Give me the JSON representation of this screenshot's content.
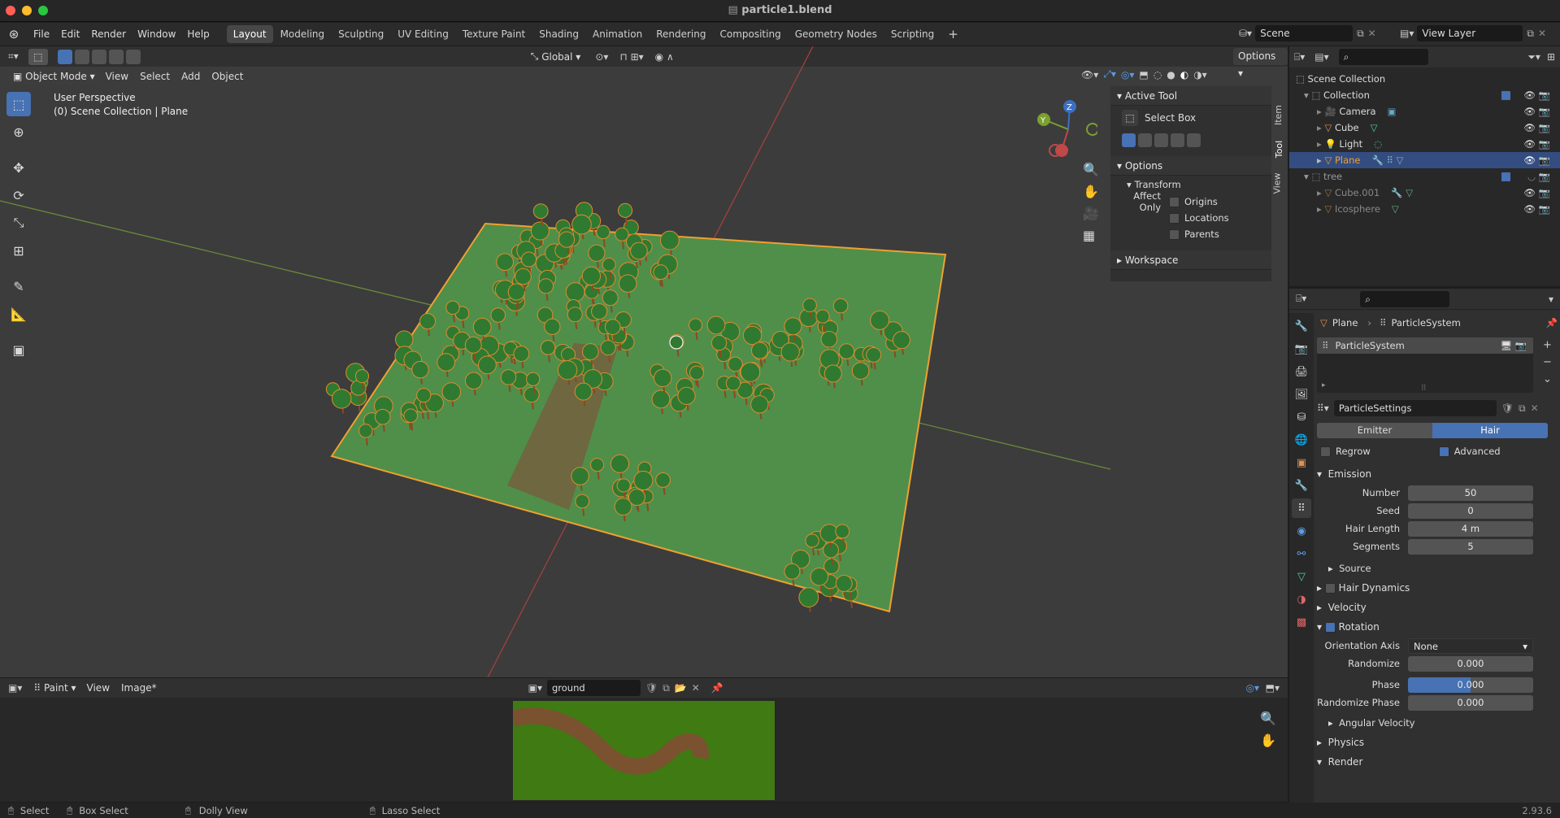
{
  "window": {
    "title": "particle1.blend"
  },
  "menu": [
    "File",
    "Edit",
    "Render",
    "Window",
    "Help"
  ],
  "workspaces": [
    "Layout",
    "Modeling",
    "Sculpting",
    "UV Editing",
    "Texture Paint",
    "Shading",
    "Animation",
    "Rendering",
    "Compositing",
    "Geometry Nodes",
    "Scripting"
  ],
  "scene": {
    "label": "Scene",
    "view_layer": "View Layer"
  },
  "viewport": {
    "mode": "Object Mode",
    "menus": [
      "View",
      "Select",
      "Add",
      "Object"
    ],
    "transform_orientation": "Global",
    "options": "Options",
    "perspective": "User Perspective",
    "collection_info": "(0) Scene Collection | Plane",
    "gizmo": {
      "x": "X",
      "y": "Y",
      "z": "Z"
    }
  },
  "npanel": {
    "tabs": [
      "Item",
      "Tool",
      "View"
    ],
    "active_tool_header": "Active Tool",
    "active_tool": "Select Box",
    "options_header": "Options",
    "transform_header": "Transform",
    "affect_only": "Affect Only",
    "origins": "Origins",
    "locations": "Locations",
    "parents": "Parents",
    "workspace_header": "Workspace"
  },
  "outliner": {
    "rows": [
      {
        "label": "Scene Collection"
      },
      {
        "label": "Collection"
      },
      {
        "label": "Camera"
      },
      {
        "label": "Cube"
      },
      {
        "label": "Light"
      },
      {
        "label": "Plane"
      },
      {
        "label": "tree"
      },
      {
        "label": "Cube.001"
      },
      {
        "label": "Icosphere"
      }
    ]
  },
  "properties": {
    "breadcrumb_object": "Plane",
    "breadcrumb_system": "ParticleSystem",
    "list_item": "ParticleSystem",
    "settings": "ParticleSettings",
    "type_emitter": "Emitter",
    "type_hair": "Hair",
    "regrow": "Regrow",
    "advanced": "Advanced",
    "emission": "Emission",
    "number_label": "Number",
    "number": "50",
    "seed_label": "Seed",
    "seed": "0",
    "hair_length_label": "Hair Length",
    "hair_length": "4 m",
    "segments_label": "Segments",
    "segments": "5",
    "source": "Source",
    "hair_dynamics": "Hair Dynamics",
    "velocity": "Velocity",
    "rotation": "Rotation",
    "orientation_axis_label": "Orientation Axis",
    "orientation_axis": "None",
    "randomize_label": "Randomize",
    "randomize": "0.000",
    "phase_label": "Phase",
    "phase": "0.000",
    "randomize_phase_label": "Randomize Phase",
    "randomize_phase": "0.000",
    "angular_velocity": "Angular Velocity",
    "physics": "Physics",
    "render": "Render"
  },
  "image_editor": {
    "mode": "Paint",
    "view": "View",
    "image_menu": "Image*",
    "image_name": "ground"
  },
  "status": {
    "select": "Select",
    "box_select": "Box Select",
    "dolly": "Dolly View",
    "lasso": "Lasso Select",
    "version": "2.93.6"
  },
  "colors": {
    "accent": "#4772b3",
    "selection": "#f0a030",
    "tree": "#2f7a30",
    "ground": "#4f8f4a"
  }
}
